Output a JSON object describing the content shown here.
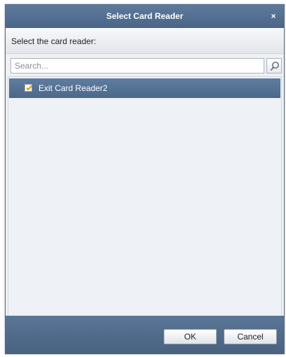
{
  "dialog": {
    "title": "Select Card Reader",
    "close_glyph": "×",
    "instruction": "Select the card reader:"
  },
  "search": {
    "placeholder": "Search...",
    "button_icon": "search-icon"
  },
  "card_readers": [
    {
      "label": "Exit Card Reader2",
      "checked": true,
      "selected": true
    }
  ],
  "buttons": {
    "ok": "OK",
    "cancel": "Cancel"
  },
  "colors": {
    "titlebar": "#4a6586",
    "selection": "#4b6888",
    "check": "#e09a00"
  }
}
